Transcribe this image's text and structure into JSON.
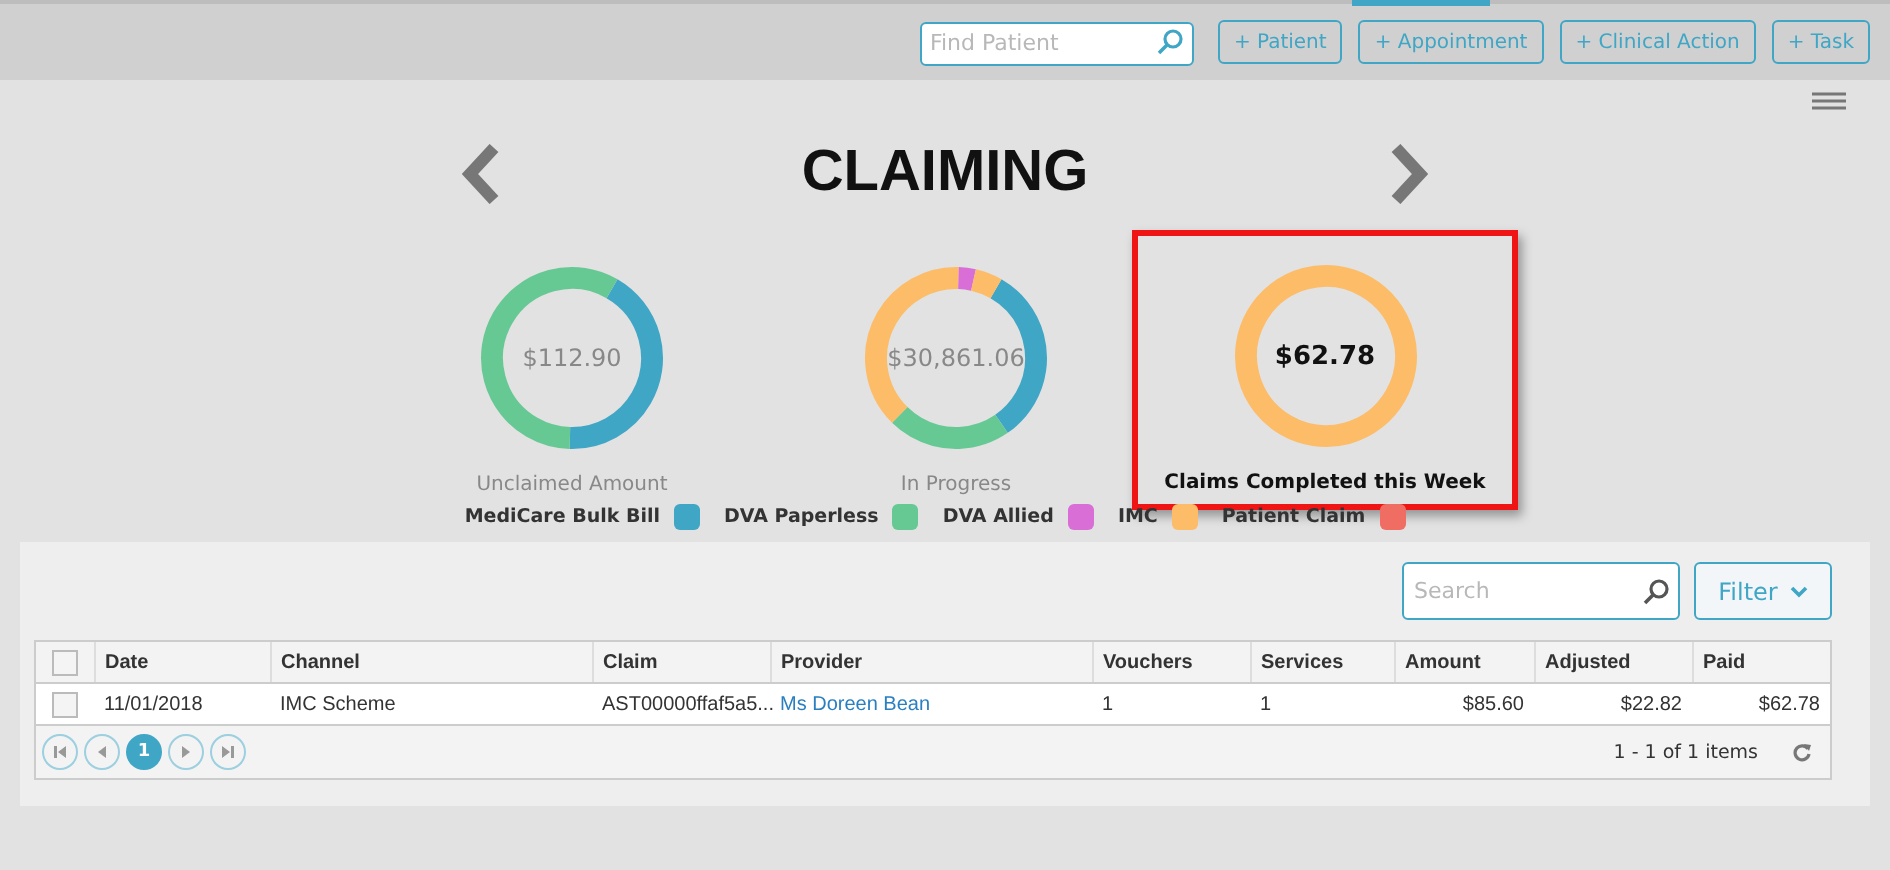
{
  "top_bar": {
    "search": {
      "placeholder": "Find Patient"
    },
    "buttons": [
      "+ Patient",
      "+ Appointment",
      "+ Clinical Action",
      "+ Task"
    ]
  },
  "title": "CLAIMING",
  "cards": [
    {
      "value": "$112.90",
      "label": "Unclaimed Amount",
      "highlighted": false
    },
    {
      "value": "$30,861.06",
      "label": "In Progress",
      "highlighted": false
    },
    {
      "value": "$62.78",
      "label": "Claims Completed this Week",
      "highlighted": true
    }
  ],
  "legend": [
    {
      "label": "MediCare Bulk Bill",
      "color": "#3fa6c6"
    },
    {
      "label": "DVA Paperless",
      "color": "#66c994"
    },
    {
      "label": "DVA Allied",
      "color": "#d96fd6"
    },
    {
      "label": "IMC",
      "color": "#fdbc68"
    },
    {
      "label": "Patient Claim",
      "color": "#ef6d63"
    }
  ],
  "table": {
    "search": {
      "placeholder": "Search"
    },
    "filter_button": "Filter",
    "header_checkbox": {
      "checked": false
    },
    "columns": [
      "Date",
      "Channel",
      "Claim",
      "Provider",
      "Vouchers",
      "Services",
      "Amount",
      "Adjusted",
      "Paid"
    ],
    "rows": [
      {
        "checked": false,
        "cells": [
          {
            "text": "11/01/2018",
            "kind": "text"
          },
          {
            "text": "IMC Scheme",
            "kind": "text"
          },
          {
            "text": "AST00000ffaf5a5...",
            "kind": "text"
          },
          {
            "text": "Ms Doreen Bean",
            "kind": "link"
          },
          {
            "text": "1",
            "kind": "text"
          },
          {
            "text": "1",
            "kind": "text"
          },
          {
            "text": "$85.60",
            "kind": "number"
          },
          {
            "text": "$22.82",
            "kind": "number"
          },
          {
            "text": "$62.78",
            "kind": "number"
          }
        ]
      }
    ],
    "pages": [
      {
        "label": "1",
        "selected": true
      }
    ],
    "info": "1 - 1 of 1 items"
  }
}
